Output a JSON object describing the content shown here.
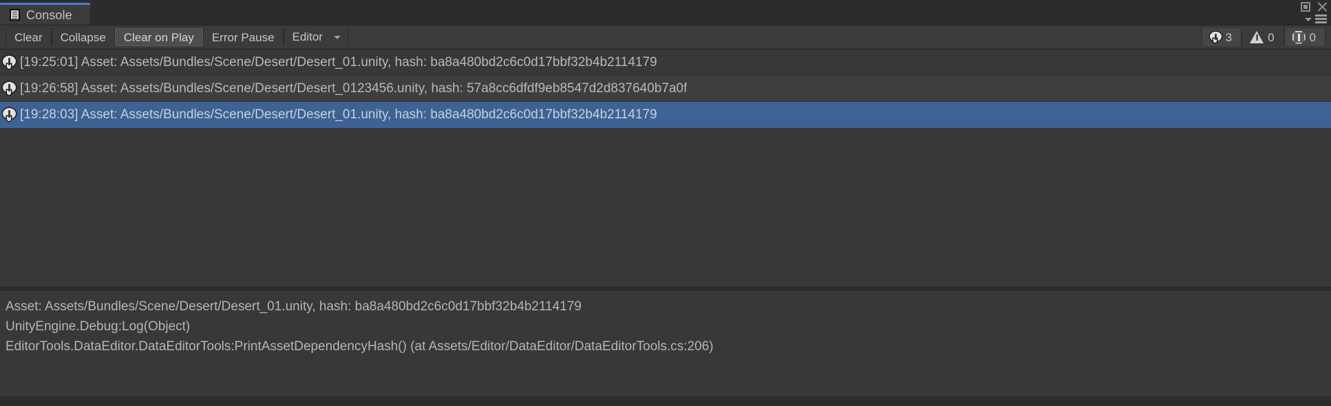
{
  "window": {
    "tab_label": "Console",
    "tab_icon": "console-document-icon",
    "maximize_icon": "maximize-icon",
    "close_icon": "close-icon",
    "caret_icon": "chevron-down-icon",
    "menu_icon": "hamburger-menu-icon"
  },
  "toolbar": {
    "clear_label": "Clear",
    "collapse_label": "Collapse",
    "clear_on_play_label": "Clear on Play",
    "error_pause_label": "Error Pause",
    "editor_label": "Editor",
    "editor_dropdown_icon": "chevron-down-icon",
    "badges": [
      {
        "icon": "log-message-icon",
        "count": "3",
        "name": "log-count-badge"
      },
      {
        "icon": "warning-icon",
        "count": "0",
        "name": "warning-count-badge"
      },
      {
        "icon": "error-icon",
        "count": "0",
        "name": "error-count-badge"
      }
    ]
  },
  "log_list": {
    "entries": [
      {
        "icon": "log-message-icon",
        "text": "[19:25:01] Asset: Assets/Bundles/Scene/Desert/Desert_01.unity, hash: ba8a480bd2c6c0d17bbf32b4b2114179",
        "selected": false
      },
      {
        "icon": "log-message-icon",
        "text": "[19:26:58] Asset: Assets/Bundles/Scene/Desert/Desert_0123456.unity, hash: 57a8cc6dfdf9eb8547d2d837640b7a0f",
        "selected": false
      },
      {
        "icon": "log-message-icon",
        "text": "[19:28:03] Asset: Assets/Bundles/Scene/Desert/Desert_01.unity, hash: ba8a480bd2c6c0d17bbf32b4b2114179",
        "selected": true
      }
    ]
  },
  "detail": {
    "lines": [
      "Asset: Assets/Bundles/Scene/Desert/Desert_01.unity, hash: ba8a480bd2c6c0d17bbf32b4b2114179",
      "UnityEngine.Debug:Log(Object)",
      "EditorTools.DataEditor.DataEditorTools:PrintAssetDependencyHash() (at Assets/Editor/DataEditor/DataEditorTools.cs:206)"
    ]
  },
  "colors": {
    "selection": "#3d6294",
    "tab_accent": "#4b7fd4",
    "panel_bg": "#383838",
    "chrome_bg": "#2c2c2c",
    "toolbar_bg": "#3b3b3b"
  }
}
